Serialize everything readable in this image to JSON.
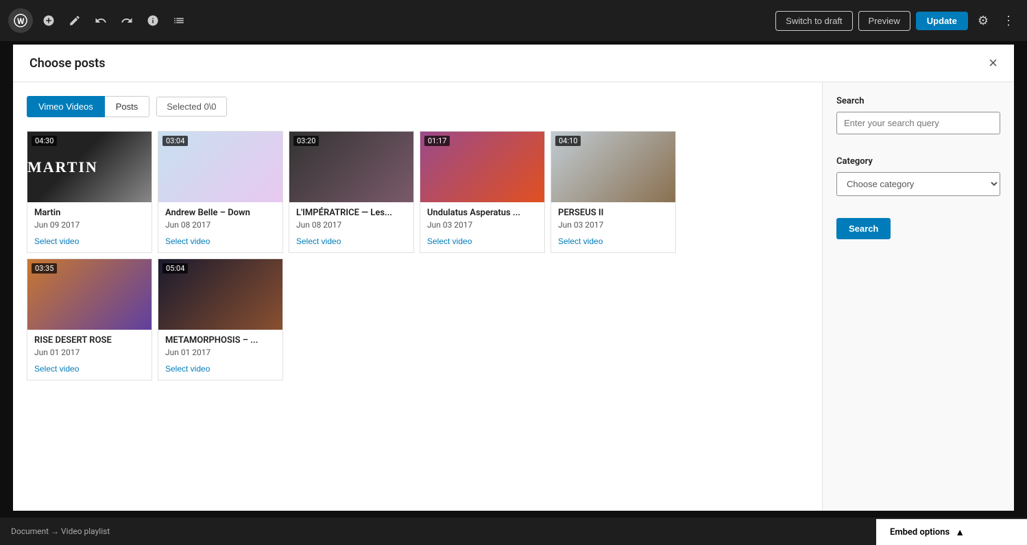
{
  "toolbar": {
    "switch_to_draft": "Switch to draft",
    "preview": "Preview",
    "update": "Update"
  },
  "modal": {
    "title": "Choose posts",
    "close_icon": "×",
    "tabs": [
      {
        "label": "Vimeo Videos",
        "active": true
      },
      {
        "label": "Posts",
        "active": false
      }
    ],
    "selected_label": "Selected 0\\0"
  },
  "videos": [
    {
      "id": 1,
      "title": "Martin",
      "date": "Jun 09 2017",
      "duration": "04:30",
      "select_label": "Select video",
      "thumb_class": "thumb-martin",
      "thumb_text": "MARTIN"
    },
    {
      "id": 2,
      "title": "Andrew Belle – Down",
      "date": "Jun 08 2017",
      "duration": "03:04",
      "select_label": "Select video",
      "thumb_class": "thumb-andrew",
      "thumb_text": ""
    },
    {
      "id": 3,
      "title": "L'IMPÉRATRICE — Les...",
      "date": "Jun 08 2017",
      "duration": "03:20",
      "select_label": "Select video",
      "thumb_class": "thumb-imperatrice",
      "thumb_text": ""
    },
    {
      "id": 4,
      "title": "Undulatus Asperatus ...",
      "date": "Jun 03 2017",
      "duration": "01:17",
      "select_label": "Select video",
      "thumb_class": "thumb-undulatus",
      "thumb_text": ""
    },
    {
      "id": 5,
      "title": "PERSEUS II",
      "date": "Jun 03 2017",
      "duration": "04:10",
      "select_label": "Select video",
      "thumb_class": "thumb-perseus",
      "thumb_text": ""
    },
    {
      "id": 6,
      "title": "RISE DESERT ROSE",
      "date": "Jun 01 2017",
      "duration": "03:35",
      "select_label": "Select video",
      "thumb_class": "thumb-rise",
      "thumb_text": ""
    },
    {
      "id": 7,
      "title": "METAMORPHOSIS – ...",
      "date": "Jun 01 2017",
      "duration": "05:04",
      "select_label": "Select video",
      "thumb_class": "thumb-metamorphosis",
      "thumb_text": ""
    }
  ],
  "sidebar": {
    "search_label": "Search",
    "search_placeholder": "Enter your search query",
    "category_label": "Category",
    "category_placeholder": "Choose category",
    "search_button": "Search"
  },
  "breadcrumb": {
    "text": "Document → Video playlist"
  },
  "bottom": {
    "embed_options": "Embed options"
  }
}
